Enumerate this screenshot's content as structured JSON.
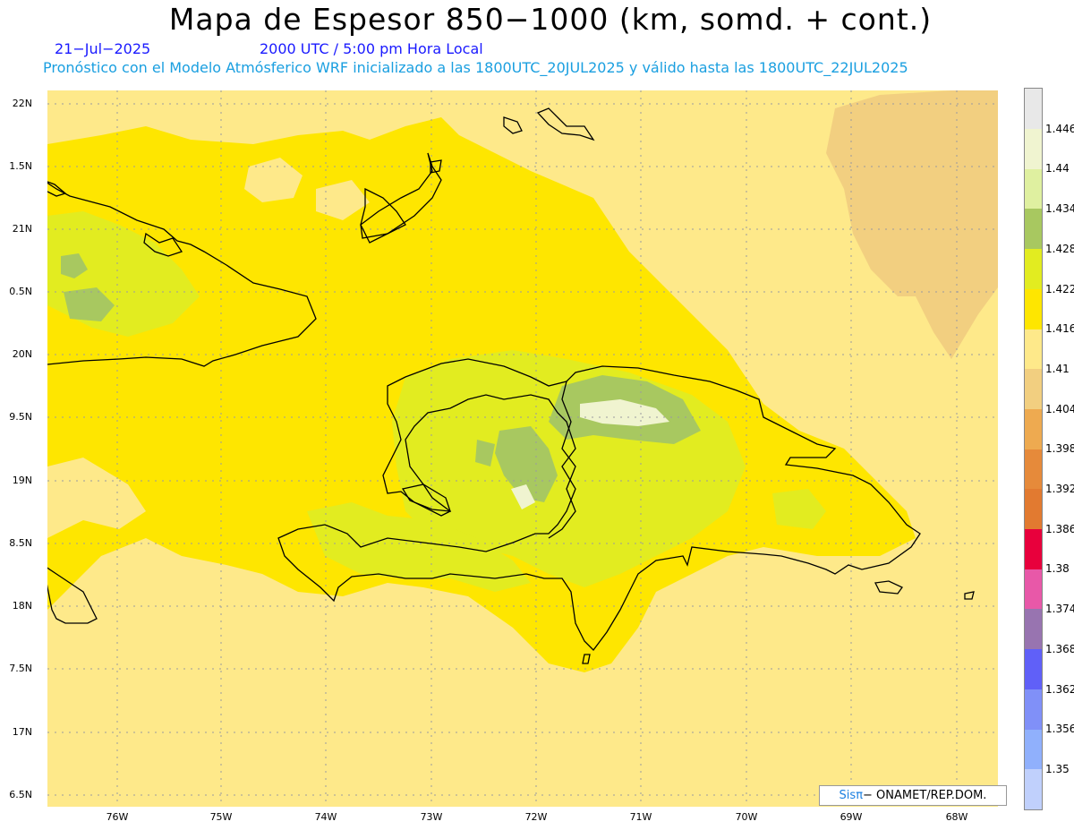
{
  "header": {
    "title": "Mapa de Espesor 850−1000 (km, somd. + cont.)",
    "date": "21−Jul−2025",
    "valid_time": "2000 UTC / 5:00 pm Hora Local",
    "description": "Pronóstico con el Modelo Atmósferico WRF inicializado a las 1800UTC_20JUL2025 y válido hasta las  1800UTC_22JUL2025"
  },
  "axes": {
    "lat_labels": [
      "22N",
      "1.5N",
      "21N",
      "0.5N",
      "20N",
      "9.5N",
      "19N",
      "8.5N",
      "18N",
      "7.5N",
      "17N",
      "6.5N"
    ],
    "lon_labels": [
      "76W",
      "75W",
      "74W",
      "73W",
      "72W",
      "71W",
      "70W",
      "69W",
      "68W"
    ]
  },
  "colorbar": {
    "levels": [
      "1.446",
      "1.44",
      "1.434",
      "1.428",
      "1.422",
      "1.416",
      "1.41",
      "1.404",
      "1.398",
      "1.392",
      "1.386",
      "1.38",
      "1.374",
      "1.368",
      "1.362",
      "1.356",
      "1.35"
    ],
    "colors": [
      "#e8e8e8",
      "#f0f4d0",
      "#dff0a0",
      "#a8c860",
      "#e2ec20",
      "#fee600",
      "#fee98a",
      "#f2cf80",
      "#eeaa50",
      "#e68a3a",
      "#e27a30",
      "#e8003c",
      "#e858a8",
      "#9874b0",
      "#6060f8",
      "#8090f8",
      "#90b0fc",
      "#c0d0fc"
    ]
  },
  "credit": {
    "brand": "Sis",
    "pi": "π",
    "text": "− ONAMET/REP.DOM."
  }
}
